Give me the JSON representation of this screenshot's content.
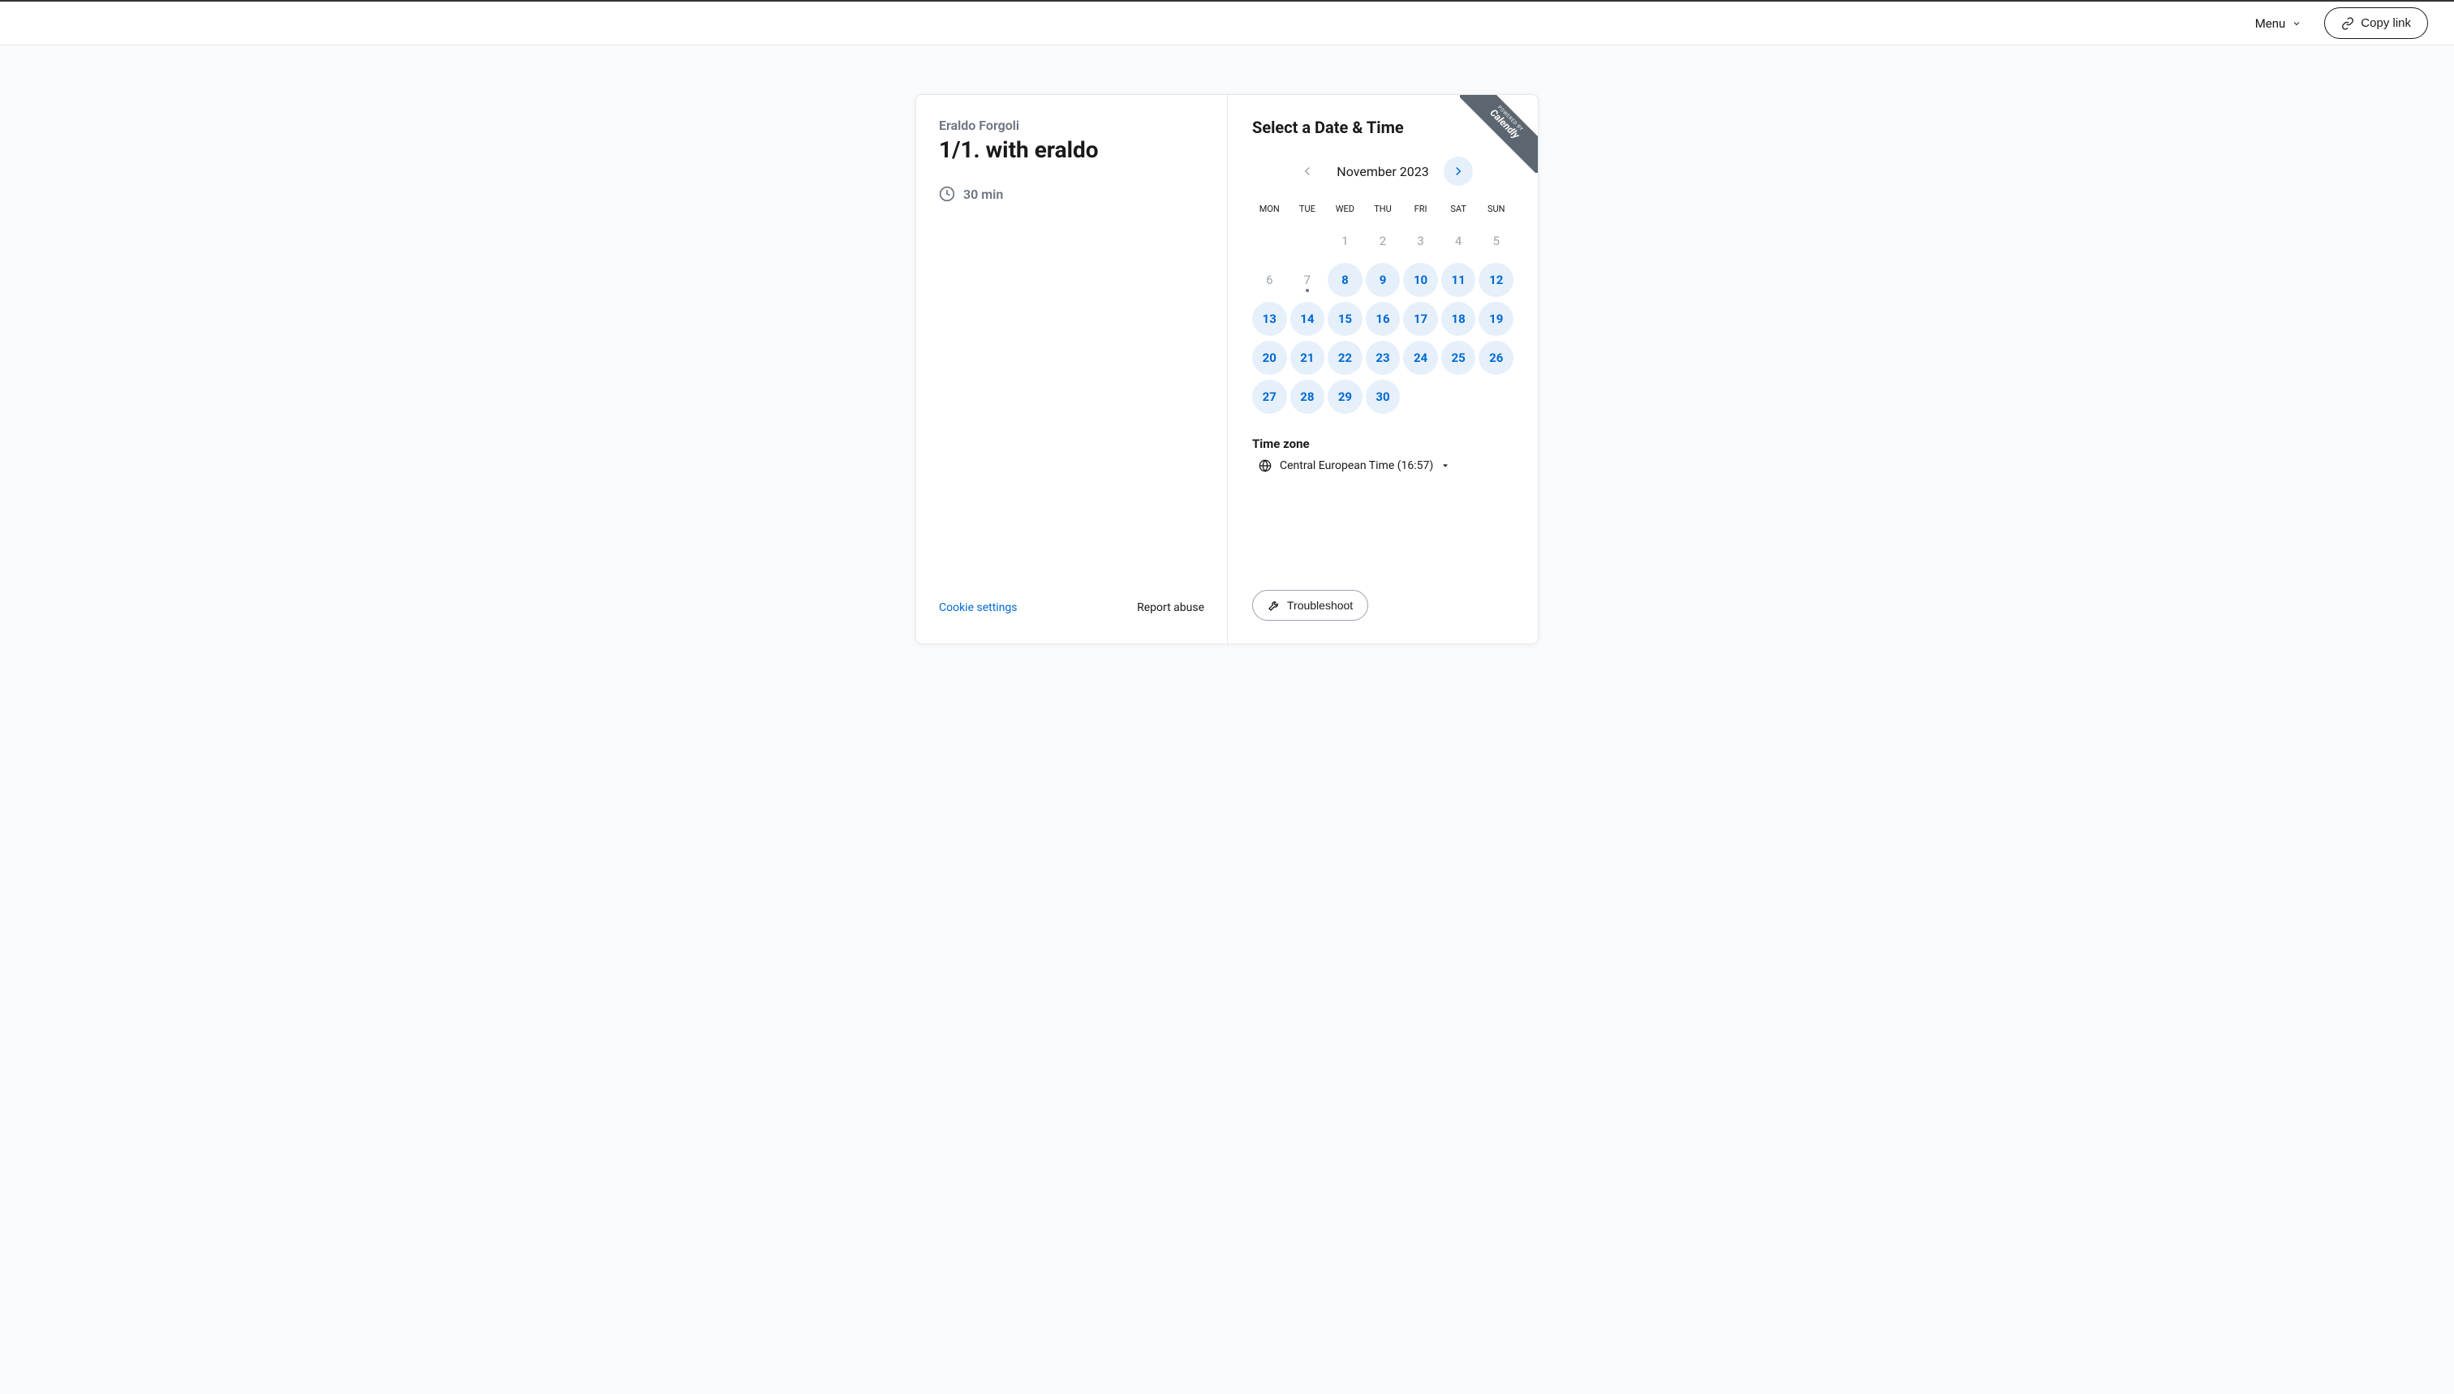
{
  "topbar": {
    "menu_label": "Menu",
    "copy_link_label": "Copy link"
  },
  "event": {
    "organizer": "Eraldo Forgoli",
    "title": "1/1. with eraldo",
    "duration": "30 min"
  },
  "footer_left": {
    "cookie": "Cookie settings",
    "report": "Report abuse"
  },
  "right": {
    "heading": "Select a Date & Time",
    "month": "November 2023",
    "day_headers": [
      "MON",
      "TUE",
      "WED",
      "THU",
      "FRI",
      "SAT",
      "SUN"
    ],
    "weeks": [
      [
        {
          "n": "",
          "state": "empty"
        },
        {
          "n": "",
          "state": "empty"
        },
        {
          "n": "1",
          "state": "unavailable"
        },
        {
          "n": "2",
          "state": "unavailable"
        },
        {
          "n": "3",
          "state": "unavailable"
        },
        {
          "n": "4",
          "state": "unavailable"
        },
        {
          "n": "5",
          "state": "unavailable"
        }
      ],
      [
        {
          "n": "6",
          "state": "unavailable"
        },
        {
          "n": "7",
          "state": "unavailable",
          "today": true
        },
        {
          "n": "8",
          "state": "available"
        },
        {
          "n": "9",
          "state": "available"
        },
        {
          "n": "10",
          "state": "available"
        },
        {
          "n": "11",
          "state": "available"
        },
        {
          "n": "12",
          "state": "available"
        }
      ],
      [
        {
          "n": "13",
          "state": "available"
        },
        {
          "n": "14",
          "state": "available"
        },
        {
          "n": "15",
          "state": "available"
        },
        {
          "n": "16",
          "state": "available"
        },
        {
          "n": "17",
          "state": "available"
        },
        {
          "n": "18",
          "state": "available"
        },
        {
          "n": "19",
          "state": "available"
        }
      ],
      [
        {
          "n": "20",
          "state": "available"
        },
        {
          "n": "21",
          "state": "available"
        },
        {
          "n": "22",
          "state": "available"
        },
        {
          "n": "23",
          "state": "available"
        },
        {
          "n": "24",
          "state": "available"
        },
        {
          "n": "25",
          "state": "available"
        },
        {
          "n": "26",
          "state": "available"
        }
      ],
      [
        {
          "n": "27",
          "state": "available"
        },
        {
          "n": "28",
          "state": "available"
        },
        {
          "n": "29",
          "state": "available"
        },
        {
          "n": "30",
          "state": "available"
        },
        {
          "n": "",
          "state": "empty"
        },
        {
          "n": "",
          "state": "empty"
        },
        {
          "n": "",
          "state": "empty"
        }
      ]
    ],
    "tz_heading": "Time zone",
    "tz_value": "Central European Time (16:57)",
    "troubleshoot": "Troubleshoot"
  },
  "banner": {
    "powered": "POWERED BY",
    "brand": "Calendly"
  }
}
